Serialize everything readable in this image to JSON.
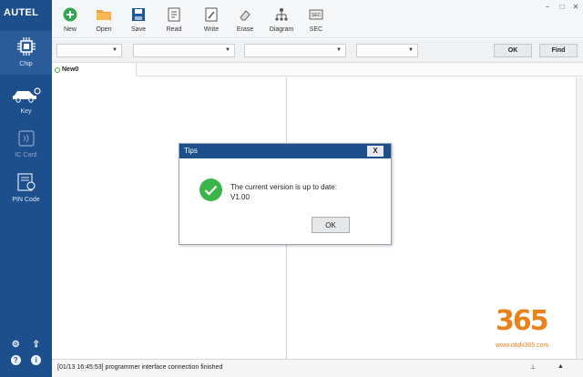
{
  "app": {
    "brand": "AUTEL"
  },
  "colors": {
    "sidebar": "#1c4f8b",
    "accent_green": "#39b54a",
    "watermark_orange": "#e9821c"
  },
  "window_controls": [
    "−",
    "□",
    "✕"
  ],
  "toolbar": {
    "items": [
      {
        "label": "New",
        "icon": "plus-circle-icon"
      },
      {
        "label": "Open",
        "icon": "folder-icon"
      },
      {
        "label": "Save",
        "icon": "floppy-icon"
      },
      {
        "label": "Read",
        "icon": "read-document-icon"
      },
      {
        "label": "Write",
        "icon": "write-pencil-icon"
      },
      {
        "label": "Erase",
        "icon": "eraser-icon"
      },
      {
        "label": "Diagram",
        "icon": "tree-diagram-icon"
      },
      {
        "label": "SEC",
        "icon": "sec-chip-icon"
      }
    ]
  },
  "sidebar": {
    "items": [
      {
        "label": "Chip",
        "icon": "chip-icon",
        "active": true
      },
      {
        "label": "Key",
        "icon": "car-key-icon"
      },
      {
        "label": "IC Card",
        "icon": "ic-card-icon",
        "disabled": true
      },
      {
        "label": "PIN Code",
        "icon": "pin-code-icon"
      }
    ],
    "bottom_icons": [
      "gear-icon",
      "upload-icon",
      "help-icon",
      "info-icon"
    ]
  },
  "filters": {
    "selects": [
      "",
      "",
      "",
      ""
    ],
    "ok_label": "OK",
    "find_label": "Find"
  },
  "tabs": [
    {
      "label": "New0"
    }
  ],
  "dialog": {
    "title": "Tips",
    "close_label": "X",
    "message_line1": "The current version is up to date:",
    "message_line2": "V1.00",
    "ok_label": "OK"
  },
  "status": {
    "text": "[01/13 16:45:53] programmer interface connection finished"
  },
  "watermark": {
    "number": "365",
    "url": "www.obdii365.com"
  }
}
